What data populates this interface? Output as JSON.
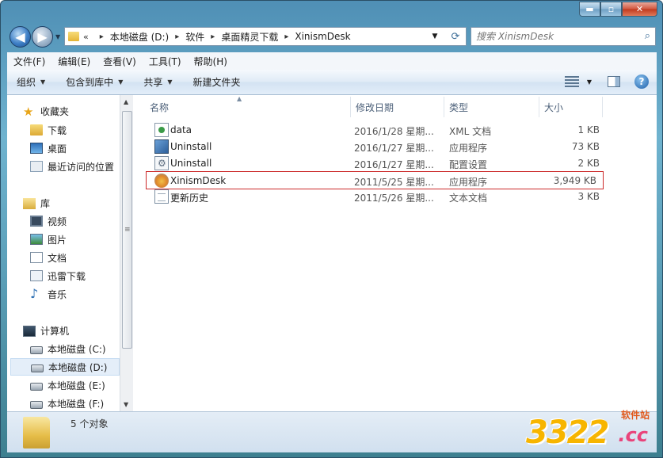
{
  "window": {
    "caption_buttons": {
      "minimize": "▬",
      "maximize": "▫",
      "close": "✕"
    }
  },
  "address": {
    "overflow": "«",
    "crumbs": [
      "本地磁盘 (D:)",
      "软件",
      "桌面精灵下载",
      "XinismDesk"
    ],
    "separator": "▸"
  },
  "search": {
    "placeholder": "搜索 XinismDesk"
  },
  "menubar": [
    "文件(F)",
    "编辑(E)",
    "查看(V)",
    "工具(T)",
    "帮助(H)"
  ],
  "commandbar": {
    "organize": "组织",
    "include_library": "包含到库中",
    "share": "共享",
    "new_folder": "新建文件夹"
  },
  "nav": {
    "favorites": {
      "label": "收藏夹",
      "items": [
        "下载",
        "桌面",
        "最近访问的位置"
      ]
    },
    "libraries": {
      "label": "库",
      "items": [
        "视频",
        "图片",
        "文档",
        "迅雷下载",
        "音乐"
      ]
    },
    "computer": {
      "label": "计算机",
      "items": [
        "本地磁盘 (C:)",
        "本地磁盘 (D:)",
        "本地磁盘 (E:)",
        "本地磁盘 (F:)"
      ]
    }
  },
  "columns": {
    "name": "名称",
    "modified": "修改日期",
    "type": "类型",
    "size": "大小"
  },
  "files": [
    {
      "name": "data",
      "date": "2016/1/28 星期...",
      "type": "XML 文档",
      "size": "1 KB",
      "icon": "xml-file-icon"
    },
    {
      "name": "Uninstall",
      "date": "2016/1/27 星期...",
      "type": "应用程序",
      "size": "73 KB",
      "icon": "installer-icon"
    },
    {
      "name": "Uninstall",
      "date": "2016/1/27 星期...",
      "type": "配置设置",
      "size": "2 KB",
      "icon": "config-file-icon"
    },
    {
      "name": "XinismDesk",
      "date": "2011/5/25 星期...",
      "type": "应用程序",
      "size": "3,949 KB",
      "icon": "app-icon"
    },
    {
      "name": "更新历史",
      "date": "2011/5/26 星期...",
      "type": "文本文档",
      "size": "3 KB",
      "icon": "text-file-icon"
    }
  ],
  "status": {
    "text": "5 个对象"
  },
  "watermark": {
    "number": "3322",
    "soft": "软件站",
    "tld": ".cc"
  }
}
